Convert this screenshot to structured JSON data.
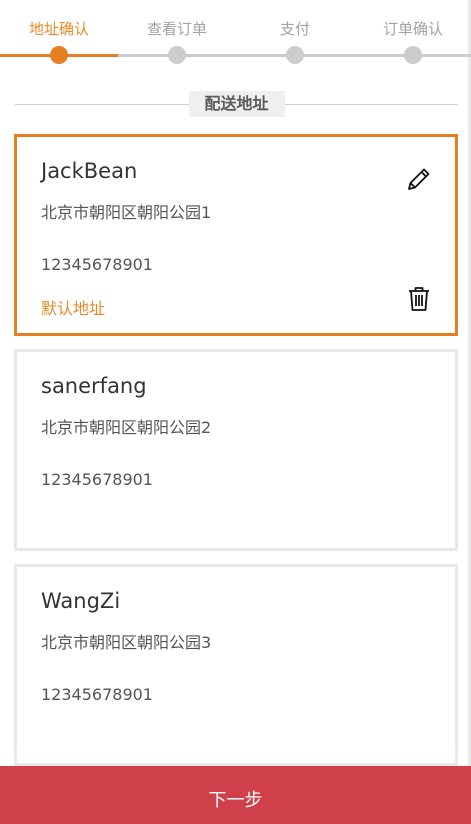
{
  "steps": [
    {
      "label": "地址确认",
      "active": true
    },
    {
      "label": "查看订单",
      "active": false
    },
    {
      "label": "支付",
      "active": false
    },
    {
      "label": "订单确认",
      "active": false
    }
  ],
  "section_title": "配送地址",
  "addresses": [
    {
      "name": "JackBean",
      "address": "北京市朝阳区朝阳公园1",
      "phone": "12345678901",
      "default_label": "默认地址",
      "selected": true
    },
    {
      "name": "sanerfang",
      "address": "北京市朝阳区朝阳公园2",
      "phone": "12345678901",
      "selected": false
    },
    {
      "name": "WangZi",
      "address": "北京市朝阳区朝阳公园3",
      "phone": "12345678901",
      "selected": false
    }
  ],
  "icons": {
    "edit": "pencil-icon",
    "delete": "trash-icon"
  },
  "next_button": "下一步",
  "colors": {
    "accent": "#e67e22",
    "button": "#d0404a",
    "inactive": "#cccccc"
  }
}
